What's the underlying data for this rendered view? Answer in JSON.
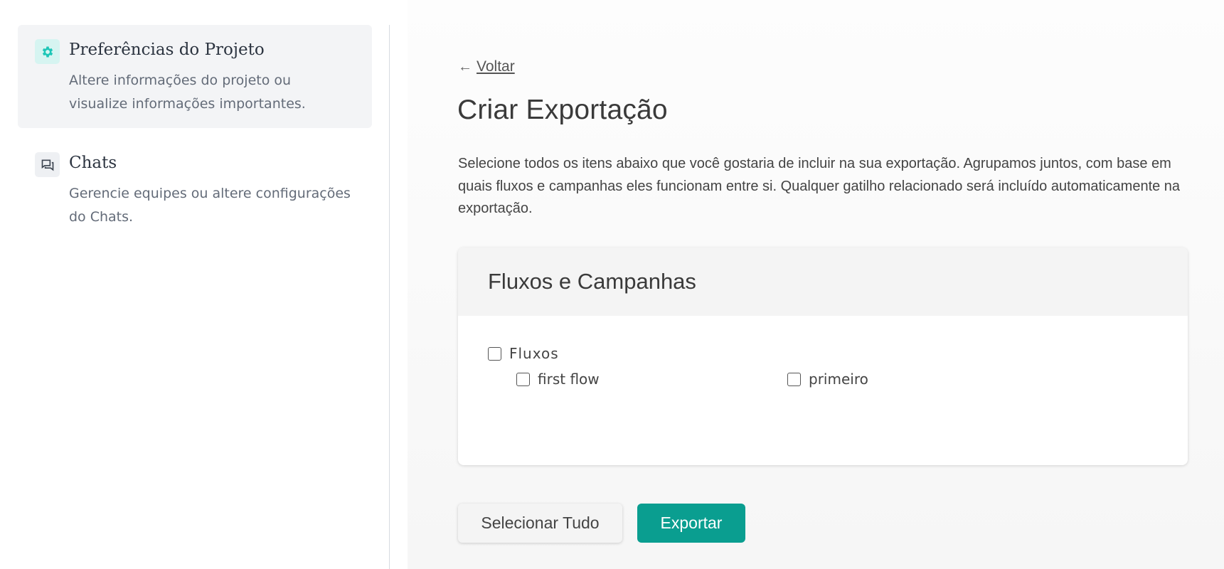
{
  "sidebar": {
    "items": [
      {
        "title": "Preferências do Projeto",
        "description": "Altere informações do projeto ou visualize informações importantes.",
        "icon": "gear-icon",
        "active": true
      },
      {
        "title": "Chats",
        "description": "Gerencie equipes ou altere configurações do Chats.",
        "icon": "chat-icon",
        "active": false
      }
    ]
  },
  "main": {
    "back_arrow": "←",
    "back_label": "Voltar",
    "title": "Criar Exportação",
    "description": "Selecione todos os itens abaixo que você gostaria de incluir na sua exportação. Agrupamos juntos, com base em quais fluxos e campanhas eles funcionam entre si. Qualquer gatilho relacionado será incluído automaticamente na exportação.",
    "card": {
      "title": "Fluxos e Campanhas",
      "group_label": "Fluxos",
      "items": [
        {
          "label": "first flow",
          "checked": false
        },
        {
          "label": "primeiro",
          "checked": false
        }
      ]
    },
    "buttons": {
      "select_all": "Selecionar Tudo",
      "export": "Exportar"
    }
  },
  "colors": {
    "accent": "#0a9e90",
    "icon_teal": "#1ec6b7"
  }
}
